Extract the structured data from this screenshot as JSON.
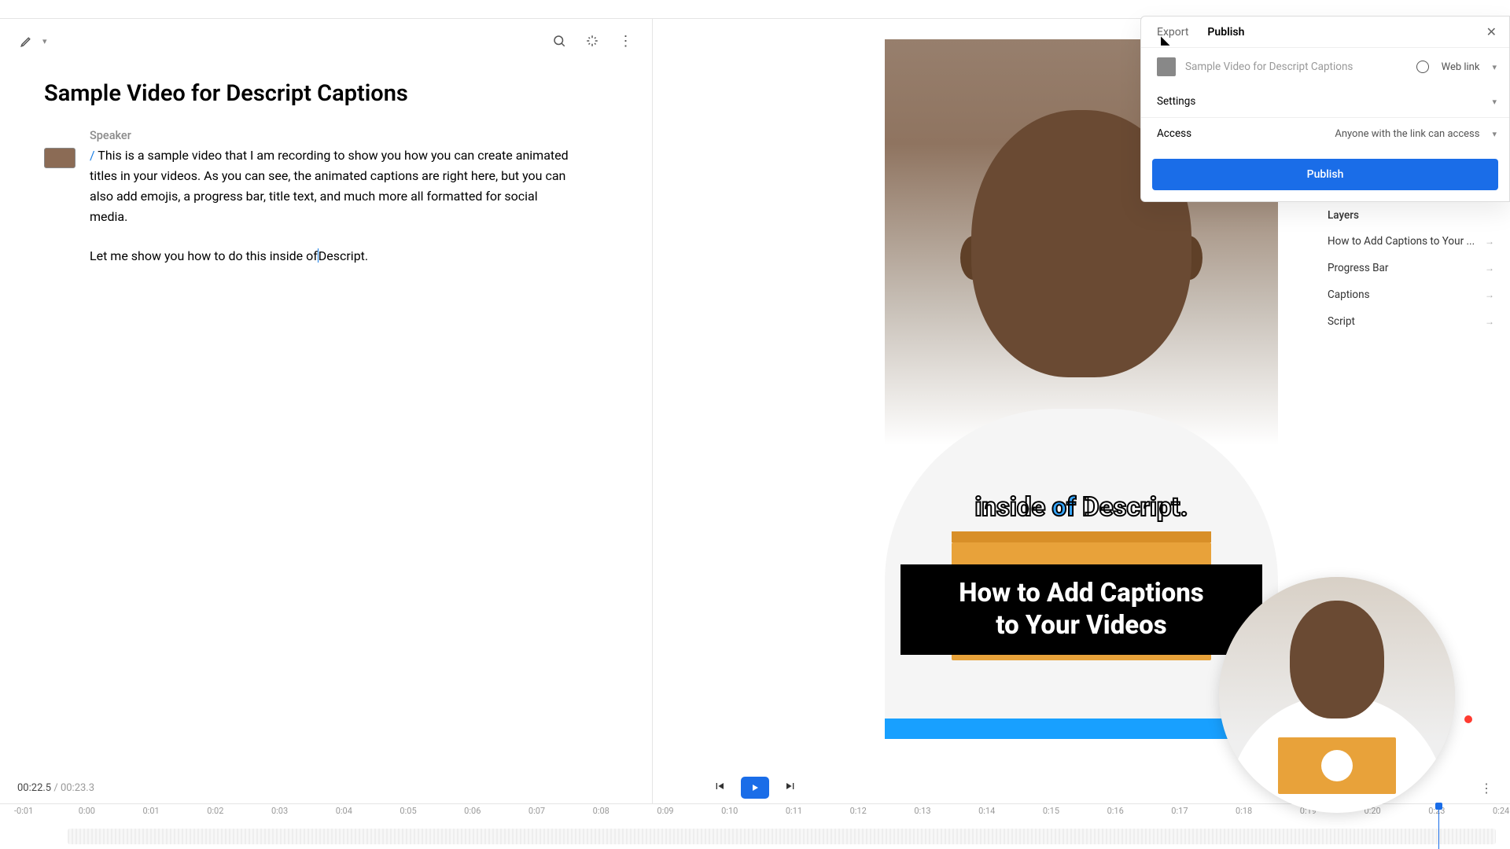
{
  "title": "Sample Video for Descript Captions",
  "speaker_label": "Speaker",
  "transcript": {
    "p1_before": "This is a sample video that I am recording to show you how you can create animated titles in your videos. As you can see, the animated captions are right here, but you can also add emojis, a progress bar, title text, and much more all formatted for social media.",
    "p2_before": "Let me show you how to do this inside of",
    "p2_after": "Descript."
  },
  "caption": {
    "w1": "inside",
    "w2": "of",
    "w3": "Descript."
  },
  "video_title_line1": "How to Add Captions",
  "video_title_line2": "to Your Videos",
  "publish": {
    "tab_export": "Export",
    "tab_publish": "Publish",
    "file_name": "Sample Video for Descript Captions",
    "link_type": "Web link",
    "settings": "Settings",
    "access_label": "Access",
    "access_value": "Anyone with the link can access",
    "button": "Publish"
  },
  "layers": {
    "title": "Layers",
    "items": [
      "How to Add Captions to Your ...",
      "Progress Bar",
      "Captions",
      "Script"
    ]
  },
  "time": {
    "current": "00:22.5",
    "sep": " / ",
    "total": "00:23.3"
  },
  "ticks": [
    "-0:01",
    "0:00",
    "0:01",
    "0:02",
    "0:03",
    "0:04",
    "0:05",
    "0:06",
    "0:07",
    "0:08",
    "0:09",
    "0:10",
    "0:11",
    "0:12",
    "0:13",
    "0:14",
    "0:15",
    "0:16",
    "0:17",
    "0:18",
    "0:19",
    "0:20",
    "0:23",
    "0:24"
  ]
}
